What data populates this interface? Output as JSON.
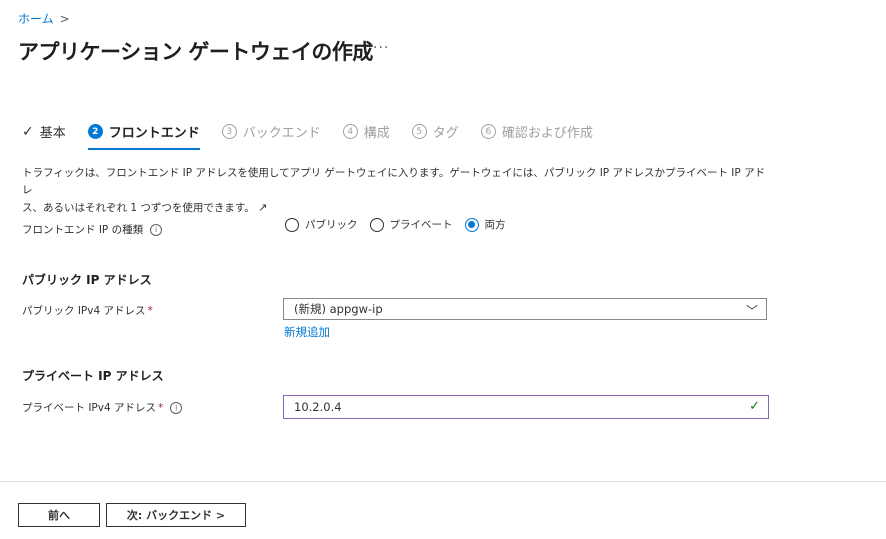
{
  "breadcrumb": {
    "home": "ホーム",
    "separator": ">"
  },
  "page": {
    "title": "アプリケーション ゲートウェイの作成",
    "more": "···"
  },
  "steps": [
    {
      "label": "基本",
      "state": "done"
    },
    {
      "num": "2",
      "label": "フロントエンド",
      "state": "active"
    },
    {
      "num": "3",
      "label": "バックエンド",
      "state": "pending"
    },
    {
      "num": "4",
      "label": "構成",
      "state": "pending"
    },
    {
      "num": "5",
      "label": "タグ",
      "state": "pending"
    },
    {
      "num": "6",
      "label": "確認および作成",
      "state": "pending"
    }
  ],
  "description": {
    "line1": "トラフィックは、フロントエンド IP アドレスを使用してアプリ ゲートウェイに入ります。ゲートウェイには、パブリック IP アドレスかプライベート IP アドレ",
    "line2": "ス、あるいはそれぞれ 1 つずつを使用できます。"
  },
  "frontend_ip": {
    "label": "フロントエンド IP の種類",
    "options": [
      "パブリック",
      "プライベート",
      "両方"
    ],
    "selected": "両方"
  },
  "public_ip": {
    "heading": "パブリック IP アドレス",
    "label": "パブリック IPv4 アドレス",
    "required_mark": "*",
    "value": "(新規) appgw-ip",
    "add_link": "新規追加"
  },
  "private_ip": {
    "heading": "プライベート IP アドレス",
    "label": "プライベート IPv4 アドレス",
    "required_mark": "*",
    "value": "10.2.0.4"
  },
  "footer": {
    "prev_label": "前へ",
    "next_label": "次: バックエンド >"
  },
  "colors": {
    "accent": "#0078d4",
    "required": "#a4262c",
    "valid": "#107c10",
    "focus_border": "#8764b8"
  }
}
